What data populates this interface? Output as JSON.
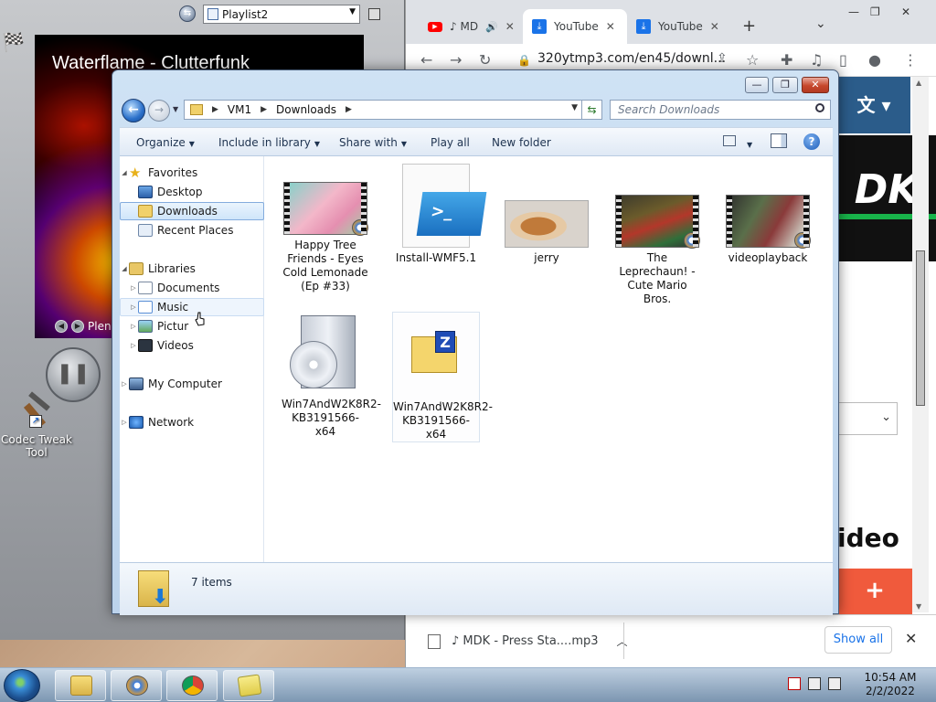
{
  "wmp": {
    "playlist": "Playlist2",
    "now_playing_title": "Waterflame - Clutterfunk",
    "now_playing_label": "Plen"
  },
  "desktop": {
    "icons": [
      {
        "label": "Codec Tweak Tool"
      }
    ]
  },
  "chrome": {
    "tabs": [
      {
        "label": "♪ MD",
        "icon": "youtube-icon"
      },
      {
        "label": "YouTube",
        "icon": "download-icon"
      },
      {
        "label": "YouTube",
        "icon": "download-icon"
      }
    ],
    "new_tab": "+",
    "tab_search": "⌄",
    "window_controls": {
      "min": "—",
      "max": "❐",
      "close": "✕"
    },
    "url": "320ytmp3.com/en45/downl...",
    "banner_text": "",
    "logo_text": "DK",
    "heading_fragment": "ideo",
    "add_button": "+",
    "download_bar": {
      "file": "♪ MDK - Press Sta....mp3",
      "show_all": "Show all",
      "close": "✕"
    }
  },
  "explorer": {
    "caption": {
      "min": "—",
      "max": "❐",
      "close": "✕"
    },
    "breadcrumb": [
      "VM1",
      "Downloads"
    ],
    "search_placeholder": "Search Downloads",
    "commands": {
      "organize": "Organize",
      "include_in_library": "Include in library",
      "share_with": "Share with",
      "play_all": "Play all",
      "new_folder": "New folder"
    },
    "nav": {
      "favorites": "Favorites",
      "desktop": "Desktop",
      "downloads": "Downloads",
      "recent_places": "Recent Places",
      "libraries": "Libraries",
      "documents": "Documents",
      "music": "Music",
      "pictures": "Pictur",
      "videos": "Videos",
      "my_computer": "My Computer",
      "network": "Network"
    },
    "files": [
      {
        "name": "Happy Tree Friends - Eyes Cold Lemonade (Ep #33)",
        "type": "video"
      },
      {
        "name": "Install-WMF5.1",
        "type": "powershell-script"
      },
      {
        "name": "jerry",
        "type": "image"
      },
      {
        "name": "The Leprechaun! - Cute Mario Bros.",
        "type": "video"
      },
      {
        "name": "videoplayback",
        "type": "video"
      },
      {
        "name": "Win7AndW2K8R2-KB3191566-x64",
        "type": "installer"
      },
      {
        "name": "Win7AndW2K8R2-KB3191566-x64",
        "type": "zip"
      }
    ],
    "item_count": "7 items"
  },
  "taskbar": {
    "time": "10:54 AM",
    "date": "2/2/2022"
  }
}
